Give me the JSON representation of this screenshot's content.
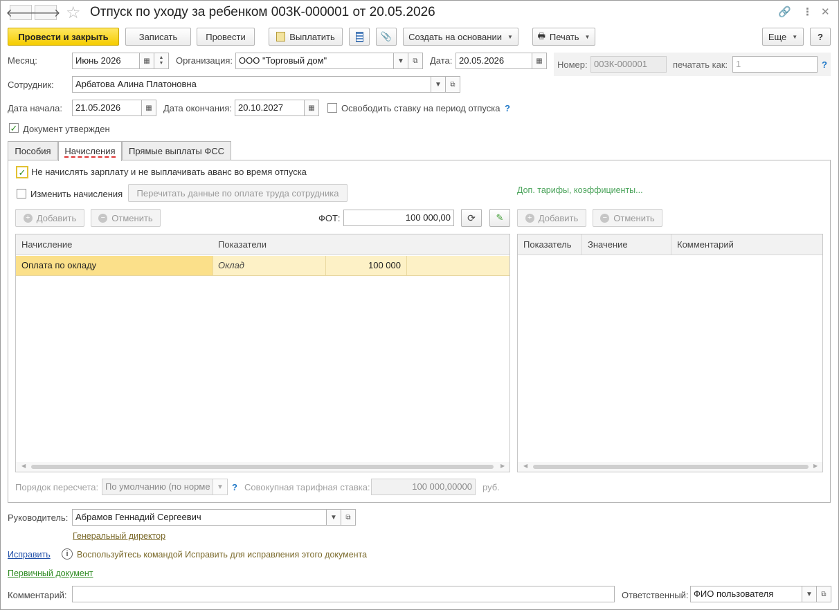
{
  "window": {
    "title": "Отпуск по уходу за ребенком 003К-000001 от 20.05.2026"
  },
  "icons": {
    "back": "arrow-left-icon",
    "forward": "arrow-right-icon",
    "favorite": "star-icon",
    "link": "link-icon",
    "more": "more-vertical-icon",
    "close": "close-icon"
  },
  "toolbar": {
    "post_and_close": "Провести и закрыть",
    "save": "Записать",
    "post": "Провести",
    "pay": "Выплатить",
    "create_based_on": "Создать на основании",
    "print": "Печать",
    "more": "Еще",
    "help": "?"
  },
  "header": {
    "month_label": "Месяц:",
    "month_value": "Июнь 2026",
    "org_label": "Организация:",
    "org_value": "ООО \"Торговый дом\"",
    "date_label": "Дата:",
    "date_value": "20.05.2026",
    "number_label": "Номер:",
    "number_value": "003К-000001",
    "print_as_label": "печатать как:",
    "print_as_placeholder": "1",
    "employee_label": "Сотрудник:",
    "employee_value": "Арбатова Алина Платоновна",
    "start_label": "Дата начала:",
    "start_value": "21.05.2026",
    "end_label": "Дата окончания:",
    "end_value": "20.10.2027",
    "free_rate_label": "Освободить ставку на период отпуска",
    "approved_label": "Документ утвержден",
    "approved_checked": true
  },
  "tabs": [
    {
      "label": "Пособия",
      "active": false
    },
    {
      "label": "Начисления",
      "active": true
    },
    {
      "label": "Прямые выплаты ФСС",
      "active": false
    }
  ],
  "accruals": {
    "no_salary_label": "Не начислять зарплату и не выплачивать аванс во время отпуска",
    "no_salary_checked": true,
    "change_label": "Изменить начисления",
    "change_checked": false,
    "reread_button": "Перечитать данные по оплате труда сотрудника",
    "extra_link": "Доп. тарифы, коэффициенты...",
    "add": "Добавить",
    "cancel": "Отменить",
    "fot_label": "ФОТ:",
    "fot_value": "100 000,00",
    "add2": "Добавить",
    "cancel2": "Отменить",
    "left_table": {
      "columns": [
        "Начисление",
        "Показатели"
      ],
      "rows": [
        {
          "accrual": "Оплата по окладу",
          "indicator": "Оклад",
          "value": "100 000"
        }
      ]
    },
    "right_table": {
      "columns": [
        "Показатель",
        "Значение",
        "Комментарий"
      ],
      "rows": []
    },
    "recalc_label": "Порядок пересчета:",
    "recalc_value": "По умолчанию (по норме",
    "total_rate_label": "Совокупная тарифная ставка:",
    "total_rate_value": "100 000,00000",
    "currency": "руб."
  },
  "footer": {
    "manager_label": "Руководитель:",
    "manager_value": "Абрамов Геннадий Сергеевич",
    "manager_position": "Генеральный директор",
    "fix_link": "Исправить",
    "fix_hint": "Воспользуйтесь командой Исправить для исправления этого документа",
    "primary_doc_link": "Первичный документ",
    "comment_label": "Комментарий:",
    "comment_value": "",
    "responsible_label": "Ответственный:",
    "responsible_value": "ФИО пользователя"
  },
  "colors": {
    "primary_button": "#f5cc00",
    "selected_row": "#fbe08a",
    "row_highlight": "#fdf1c6",
    "link_green": "#4aa35a",
    "link_blue": "#1f4fa8",
    "link_olive": "#7b6a2b"
  }
}
